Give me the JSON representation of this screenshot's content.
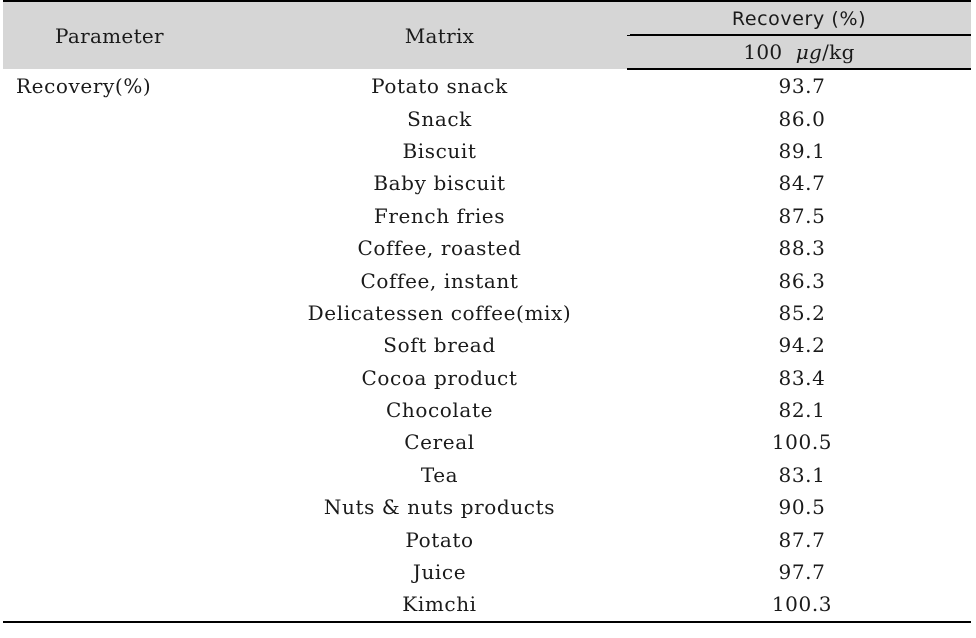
{
  "table": {
    "headers": {
      "parameter": "Parameter",
      "matrix": "Matrix",
      "recovery_group": "Recovery (%)",
      "concentration": "100",
      "concentration_unit_mu": "μg",
      "concentration_unit_rest": "/kg"
    },
    "parameter_label": "Recovery(%)",
    "rows": [
      {
        "matrix": "Potato snack",
        "value": "93.7"
      },
      {
        "matrix": "Snack",
        "value": "86.0"
      },
      {
        "matrix": "Biscuit",
        "value": "89.1"
      },
      {
        "matrix": "Baby biscuit",
        "value": "84.7"
      },
      {
        "matrix": "French fries",
        "value": "87.5"
      },
      {
        "matrix": "Coffee, roasted",
        "value": "88.3"
      },
      {
        "matrix": "Coffee, instant",
        "value": "86.3"
      },
      {
        "matrix": "Delicatessen coffee(mix)",
        "value": "85.2"
      },
      {
        "matrix": "Soft bread",
        "value": "94.2"
      },
      {
        "matrix": "Cocoa product",
        "value": "83.4"
      },
      {
        "matrix": "Chocolate",
        "value": "82.1"
      },
      {
        "matrix": "Cereal",
        "value": "100.5"
      },
      {
        "matrix": "Tea",
        "value": "83.1"
      },
      {
        "matrix": "Nuts & nuts products",
        "value": "90.5"
      },
      {
        "matrix": "Potato",
        "value": "87.7"
      },
      {
        "matrix": "Juice",
        "value": "97.7"
      },
      {
        "matrix": "Kimchi",
        "value": "100.3"
      }
    ]
  },
  "colors": {
    "header_background": "#d6d6d6",
    "rule": "#000000",
    "text": "#1a1a1a"
  }
}
